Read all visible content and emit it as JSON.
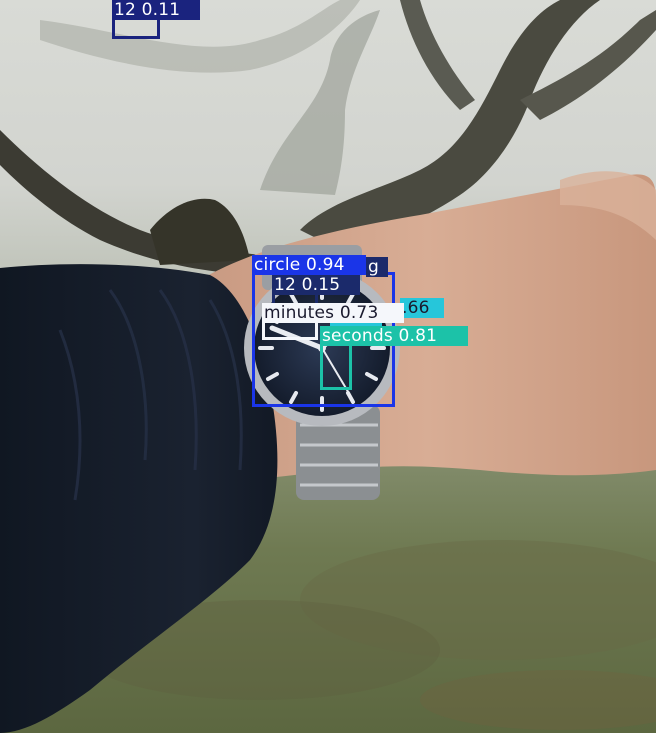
{
  "detections": [
    {
      "id": "twelve-top",
      "label": "12 0.11",
      "color": "#1a237e"
    },
    {
      "id": "circle",
      "label": "circle 0.94",
      "color": "#1a35e8"
    },
    {
      "id": "hidden-label",
      "label": "g",
      "color": "#1b2a6b"
    },
    {
      "id": "twelve-watch",
      "label": "12 0.15",
      "color": "#1b2a6b"
    },
    {
      "id": "hours",
      "label": ".66",
      "color": "#26c6da"
    },
    {
      "id": "minutes",
      "label": "minutes 0.73",
      "color": "#f5f7fb"
    },
    {
      "id": "seconds",
      "label": "seconds 0.81",
      "color": "#1cc2a8"
    }
  ]
}
